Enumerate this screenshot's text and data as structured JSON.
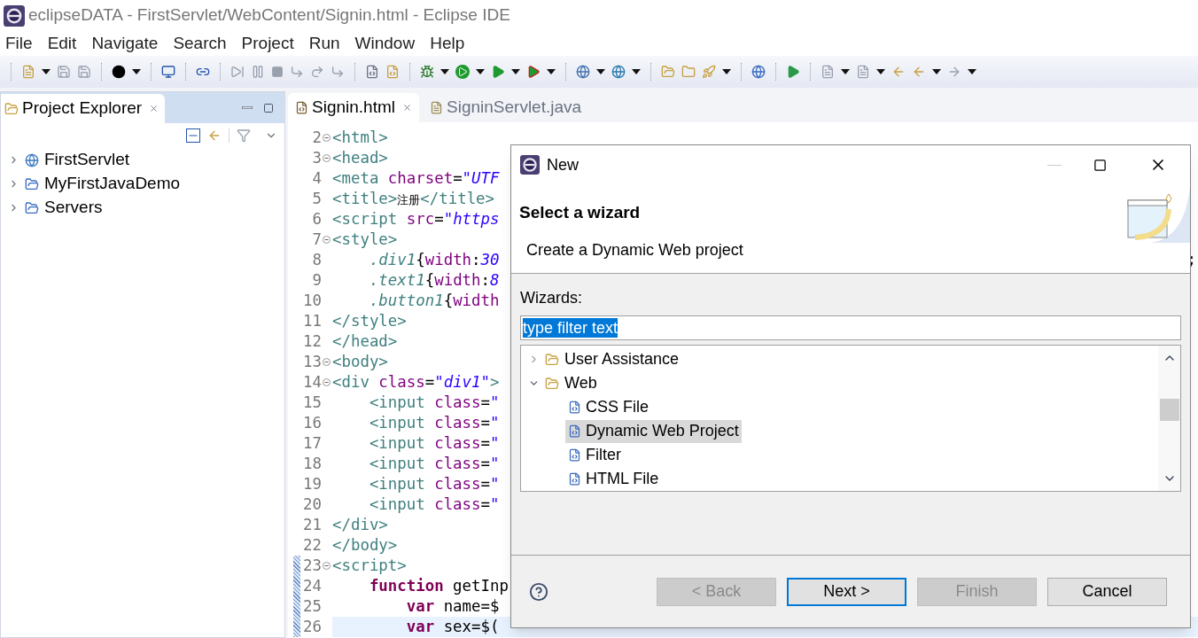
{
  "window": {
    "title": "eclipseDATA - FirstServlet/WebContent/Signin.html - Eclipse IDE"
  },
  "menu": [
    "File",
    "Edit",
    "Navigate",
    "Search",
    "Project",
    "Run",
    "Window",
    "Help"
  ],
  "project_explorer": {
    "title": "Project Explorer",
    "items": [
      {
        "label": "FirstServlet",
        "kind": "web"
      },
      {
        "label": "MyFirstJavaDemo",
        "kind": "java"
      },
      {
        "label": "Servers",
        "kind": "folder"
      }
    ]
  },
  "editor": {
    "tabs": [
      {
        "label": "Signin.html",
        "selected": true,
        "kind": "html"
      },
      {
        "label": "SigninServlet.java",
        "selected": false,
        "kind": "java"
      }
    ],
    "lines": [
      {
        "number": "2",
        "foldable": true,
        "current": false,
        "kind": "top",
        "tokens": [
          {
            "kind": "tag",
            "text": "<html>"
          }
        ]
      },
      {
        "number": "3",
        "foldable": true,
        "current": false,
        "kind": "top",
        "tokens": [
          {
            "kind": "tag",
            "text": "<head>"
          }
        ]
      },
      {
        "number": "4",
        "foldable": false,
        "current": false,
        "kind": "top",
        "tokens": [
          {
            "kind": "tag",
            "text": "<meta"
          },
          {
            "kind": "attr",
            "text": " charset"
          },
          {
            "kind": "plain",
            "text": "="
          },
          {
            "kind": "string",
            "text": "\"UTF"
          }
        ]
      },
      {
        "number": "5",
        "foldable": false,
        "current": false,
        "kind": "top",
        "tokens": [
          {
            "kind": "tag",
            "text": "<title>"
          },
          {
            "kind": "cjk",
            "text": "注册"
          },
          {
            "kind": "tag",
            "text": "</title>"
          }
        ]
      },
      {
        "number": "6",
        "foldable": false,
        "current": false,
        "kind": "top",
        "tokens": [
          {
            "kind": "tag",
            "text": "<script"
          },
          {
            "kind": "attr",
            "text": " src"
          },
          {
            "kind": "plain",
            "text": "="
          },
          {
            "kind": "string",
            "text": "\"https"
          }
        ]
      },
      {
        "number": "7",
        "foldable": true,
        "current": false,
        "kind": "top",
        "tokens": [
          {
            "kind": "tag",
            "text": "<style>"
          }
        ]
      },
      {
        "number": "8",
        "foldable": false,
        "current": false,
        "kind": "inner",
        "tokens": [
          {
            "kind": "selector",
            "text": ".div1"
          },
          {
            "kind": "plain",
            "text": "{"
          },
          {
            "kind": "attr",
            "text": "width"
          },
          {
            "kind": "plain",
            "text": ":"
          },
          {
            "kind": "string",
            "text": "30"
          }
        ],
        "tail": ";"
      },
      {
        "number": "9",
        "foldable": false,
        "current": false,
        "kind": "inner",
        "tokens": [
          {
            "kind": "selector",
            "text": ".text1"
          },
          {
            "kind": "plain",
            "text": "{"
          },
          {
            "kind": "attr",
            "text": "width"
          },
          {
            "kind": "plain",
            "text": ":"
          },
          {
            "kind": "string",
            "text": "8"
          }
        ]
      },
      {
        "number": "10",
        "foldable": false,
        "current": false,
        "kind": "inner",
        "tokens": [
          {
            "kind": "selector",
            "text": ".button1"
          },
          {
            "kind": "plain",
            "text": "{"
          },
          {
            "kind": "attr",
            "text": "width"
          }
        ]
      },
      {
        "number": "11",
        "foldable": false,
        "current": false,
        "kind": "top",
        "tokens": [
          {
            "kind": "tag",
            "text": "</style>"
          }
        ]
      },
      {
        "number": "12",
        "foldable": false,
        "current": false,
        "kind": "top",
        "tokens": [
          {
            "kind": "tag",
            "text": "</head>"
          }
        ]
      },
      {
        "number": "13",
        "foldable": true,
        "current": false,
        "kind": "top",
        "tokens": [
          {
            "kind": "tag",
            "text": "<body>"
          }
        ]
      },
      {
        "number": "14",
        "foldable": true,
        "current": false,
        "kind": "top",
        "tokens": [
          {
            "kind": "tag",
            "text": "<div"
          },
          {
            "kind": "attr",
            "text": " class"
          },
          {
            "kind": "plain",
            "text": "="
          },
          {
            "kind": "string",
            "text": "\"div1\""
          },
          {
            "kind": "tag",
            "text": ">"
          }
        ]
      },
      {
        "number": "15",
        "foldable": false,
        "current": false,
        "kind": "inner",
        "tokens": [
          {
            "kind": "tag",
            "text": "<input"
          },
          {
            "kind": "attr",
            "text": " class"
          },
          {
            "kind": "plain",
            "text": "="
          },
          {
            "kind": "string",
            "text": "\""
          }
        ]
      },
      {
        "number": "16",
        "foldable": false,
        "current": false,
        "kind": "inner",
        "tokens": [
          {
            "kind": "tag",
            "text": "<input"
          },
          {
            "kind": "attr",
            "text": " class"
          },
          {
            "kind": "plain",
            "text": "="
          },
          {
            "kind": "string",
            "text": "\""
          }
        ]
      },
      {
        "number": "17",
        "foldable": false,
        "current": false,
        "kind": "inner",
        "tokens": [
          {
            "kind": "tag",
            "text": "<input"
          },
          {
            "kind": "attr",
            "text": " class"
          },
          {
            "kind": "plain",
            "text": "="
          },
          {
            "kind": "string",
            "text": "\""
          }
        ]
      },
      {
        "number": "18",
        "foldable": false,
        "current": false,
        "kind": "inner",
        "tokens": [
          {
            "kind": "tag",
            "text": "<input"
          },
          {
            "kind": "attr",
            "text": " class"
          },
          {
            "kind": "plain",
            "text": "="
          },
          {
            "kind": "string",
            "text": "\""
          }
        ]
      },
      {
        "number": "19",
        "foldable": false,
        "current": false,
        "kind": "inner",
        "tokens": [
          {
            "kind": "tag",
            "text": "<input"
          },
          {
            "kind": "attr",
            "text": " class"
          },
          {
            "kind": "plain",
            "text": "="
          },
          {
            "kind": "string",
            "text": "\""
          }
        ]
      },
      {
        "number": "20",
        "foldable": false,
        "current": false,
        "kind": "inner",
        "tokens": [
          {
            "kind": "tag",
            "text": "<input"
          },
          {
            "kind": "attr",
            "text": " class"
          },
          {
            "kind": "plain",
            "text": "="
          },
          {
            "kind": "string",
            "text": "\""
          }
        ]
      },
      {
        "number": "21",
        "foldable": false,
        "current": false,
        "kind": "top",
        "tokens": [
          {
            "kind": "tag",
            "text": "</div>"
          }
        ]
      },
      {
        "number": "22",
        "foldable": false,
        "current": false,
        "kind": "top",
        "tokens": [
          {
            "kind": "tag",
            "text": "</body>"
          }
        ]
      },
      {
        "number": "23",
        "foldable": true,
        "current": false,
        "kind": "top",
        "tokens": [
          {
            "kind": "tag",
            "text": "<script>"
          }
        ]
      },
      {
        "number": "24",
        "foldable": false,
        "current": false,
        "kind": "inner",
        "tokens": [
          {
            "kind": "keyword",
            "text": "function"
          },
          {
            "kind": "plain",
            "text": " getInp"
          }
        ]
      },
      {
        "number": "25",
        "foldable": false,
        "current": false,
        "kind": "deep",
        "tokens": [
          {
            "kind": "keyword",
            "text": "var"
          },
          {
            "kind": "plain",
            "text": " name=$"
          }
        ]
      },
      {
        "number": "26",
        "foldable": false,
        "current": true,
        "kind": "deep",
        "tokens": [
          {
            "kind": "keyword",
            "text": "var"
          },
          {
            "kind": "plain",
            "text": " sex=$("
          }
        ]
      }
    ]
  },
  "dialog": {
    "title": "New",
    "heading": "Select a wizard",
    "description": "Create a Dynamic Web project",
    "wizards_label": "Wizards:",
    "filter": {
      "value": "type filter text"
    },
    "tree": [
      {
        "label": "User Assistance",
        "expanded": false
      },
      {
        "label": "Web",
        "expanded": true,
        "children": [
          {
            "label": "CSS File",
            "selected": false
          },
          {
            "label": "Dynamic Web Project",
            "selected": true
          },
          {
            "label": "Filter",
            "selected": false
          },
          {
            "label": "HTML File",
            "selected": false
          }
        ]
      }
    ],
    "buttons": [
      {
        "label": "< Back",
        "disabled": true,
        "default": false
      },
      {
        "label": "Next >",
        "disabled": false,
        "default": true
      },
      {
        "label": "Finish",
        "disabled": true,
        "default": false
      },
      {
        "label": "Cancel",
        "disabled": false,
        "default": false
      }
    ]
  }
}
